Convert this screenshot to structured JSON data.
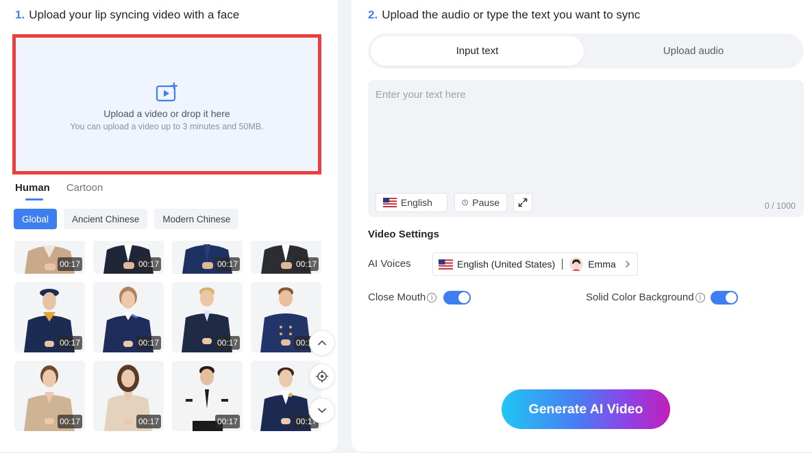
{
  "left": {
    "step_number": "1.",
    "step_title": "Upload your lip syncing video with a face",
    "dropzone": {
      "icon": "video-add-icon",
      "title": "Upload a video or drop it here",
      "subtitle": "You can upload a video up to 3 minutes and 50MB."
    },
    "category_tabs": [
      {
        "label": "Human",
        "active": true
      },
      {
        "label": "Cartoon",
        "active": false
      }
    ],
    "chips": [
      {
        "label": "Global",
        "active": true
      },
      {
        "label": "Ancient Chinese",
        "active": false
      },
      {
        "label": "Modern Chinese",
        "active": false
      }
    ],
    "avatars": [
      {
        "duration": "00:17"
      },
      {
        "duration": "00:17"
      },
      {
        "duration": "00:17"
      },
      {
        "duration": "00:17"
      },
      {
        "duration": "00:17"
      },
      {
        "duration": "00:17"
      },
      {
        "duration": "00:17"
      },
      {
        "duration": "00:17"
      },
      {
        "duration": "00:17"
      },
      {
        "duration": "00:17"
      },
      {
        "duration": "00:17"
      },
      {
        "duration": "00:17"
      }
    ],
    "float_buttons": [
      "chevron-up-icon",
      "locate-icon",
      "chevron-down-icon"
    ]
  },
  "right": {
    "step_number": "2.",
    "step_title": "Upload the audio or type the text you want to sync",
    "mode_tabs": [
      {
        "label": "Input text",
        "active": true
      },
      {
        "label": "Upload audio",
        "active": false
      }
    ],
    "text_input": {
      "placeholder": "Enter your text here",
      "value": "",
      "language": "English",
      "pause_label": "Pause",
      "counter": "0 / 1000"
    },
    "settings": {
      "heading": "Video Settings",
      "ai_voices_label": "AI Voices",
      "voice_language": "English (United States)",
      "voice_name": "Emma",
      "close_mouth_label": "Close Mouth",
      "close_mouth_on": true,
      "solid_bg_label": "Solid Color Background",
      "solid_bg_on": true
    },
    "generate_label": "Generate AI Video"
  },
  "colors": {
    "accent": "#3d7ef0",
    "dropzone_border": "#ee3d3d",
    "dropzone_bg": "#f0f5fd"
  }
}
